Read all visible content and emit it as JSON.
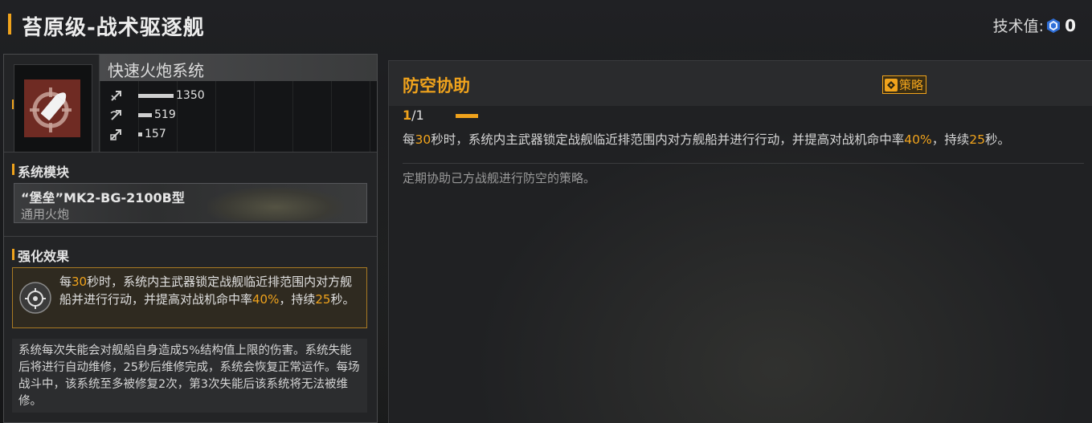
{
  "header": {
    "title": "苔原级-战术驱逐舰",
    "tech_label": "技术值:",
    "tech_value": "0"
  },
  "weapon": {
    "name": "快速火炮系统",
    "stats": [
      {
        "icon": "anti-ship-icon",
        "value": "1350",
        "level": 0.88
      },
      {
        "icon": "anti-air-icon",
        "value": "519",
        "level": 0.34
      },
      {
        "icon": "siege-icon",
        "value": "157",
        "level": 0.1
      }
    ]
  },
  "module_section": {
    "title": "系统模块",
    "module_name": "“堡垒”MK2-BG-2100B型",
    "module_type": "通用火炮"
  },
  "enhance_section": {
    "title": "强化效果",
    "effect": {
      "p1": "每",
      "n1": "30",
      "p2": "秒时，系统内主武器锁定战舰临近排范围内对方舰船并进行行动，并提高对战机命中率",
      "n2": "40%",
      "p3": "，持续",
      "n3": "25",
      "p4": "秒。"
    },
    "note": "系统每次失能会对舰船自身造成5%结构值上限的伤害。系统失能后将进行自动维修，25秒后维修完成，系统会恢复正常运作。每场战斗中，该系统至多被修复2次，第3次失能后该系统将无法被维修。"
  },
  "skill": {
    "title": "防空协助",
    "tag": "策略",
    "level_current": "1",
    "level_sep": "/",
    "level_max": "1",
    "desc": {
      "p1": "每",
      "n1": "30",
      "p2": "秒时，系统内主武器锁定战舰临近排范围内对方舰船并进行行动，并提高对战机命中率",
      "n2": "40%",
      "p3": "，持续",
      "n3": "25",
      "p4": "秒。"
    },
    "flavor": "定期协助己方战舰进行防空的策略。"
  },
  "colors": {
    "accent": "#f0a31c",
    "icon_bg": "#6f2b23"
  }
}
